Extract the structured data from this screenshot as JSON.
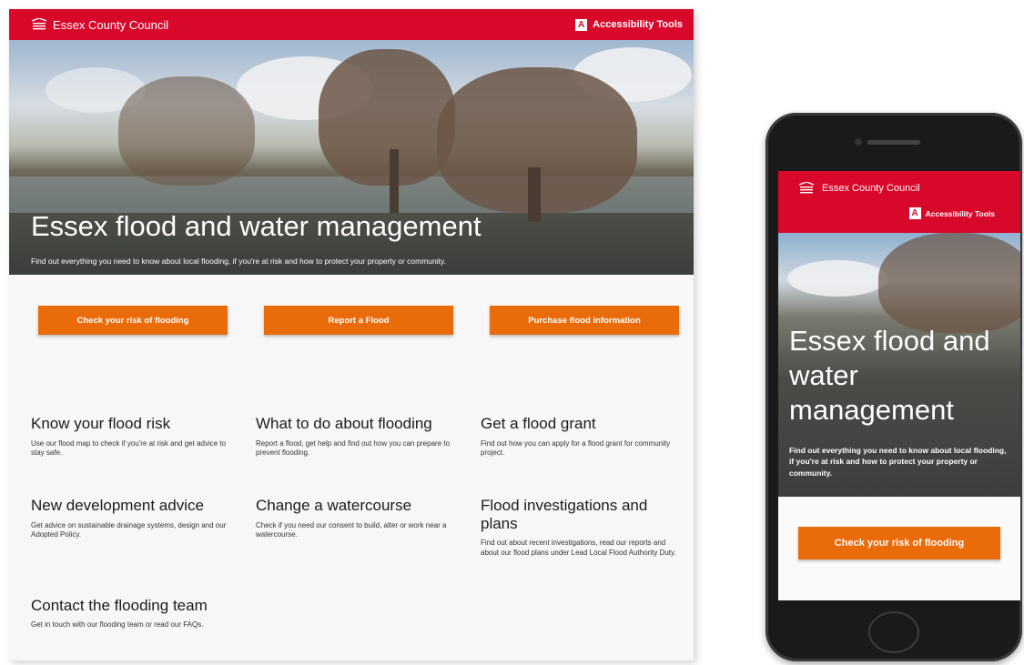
{
  "brand": {
    "name": "Essex County Council",
    "accent": "#d8082b",
    "button_color": "#ea6b0a"
  },
  "desktop": {
    "header": {
      "brand_label": "Essex County Council",
      "accessibility_label": "Accessibility Tools"
    },
    "hero": {
      "title": "Essex flood and water management",
      "subtitle": "Find out everything you need to know about local flooding, if you're at risk and how to protect your property or community."
    },
    "buttons": [
      {
        "label": "Check your risk of flooding"
      },
      {
        "label": "Report a Flood"
      },
      {
        "label": "Purchase flood information"
      }
    ],
    "cards": [
      {
        "title": "Know your flood risk",
        "text": "Use our flood map to check if you're at risk and get advice to stay safe."
      },
      {
        "title": "What to do about flooding",
        "text": "Report a flood, get help and find out how you can prepare to prevent flooding."
      },
      {
        "title": "Get a flood grant",
        "text": "Find out how you can apply for a flood grant for community project."
      },
      {
        "title": "New development advice",
        "text": "Get advice on sustainable drainage systems, design and our Adopted Policy."
      },
      {
        "title": "Change a watercourse",
        "text": "Check if you need our consent to build, alter or work near a watercourse."
      },
      {
        "title": "Flood investigations and plans",
        "text": "Find out about recent investigations, read our reports and about our flood plans under Lead Local Flood Authority Duty."
      },
      {
        "title": "Contact the flooding team",
        "text": "Get in touch with our flooding team or read our FAQs."
      }
    ]
  },
  "mobile": {
    "header": {
      "brand_label": "Essex County Council",
      "accessibility_label": "Accessibility Tools"
    },
    "hero": {
      "title": "Essex flood and water management",
      "subtitle": "Find out everything you need to know about local flooding, if you're at risk and how to protect your property or community."
    },
    "button": {
      "label": "Check your risk of flooding"
    }
  },
  "icons": [
    "council-logo-icon",
    "accessibility-icon"
  ]
}
